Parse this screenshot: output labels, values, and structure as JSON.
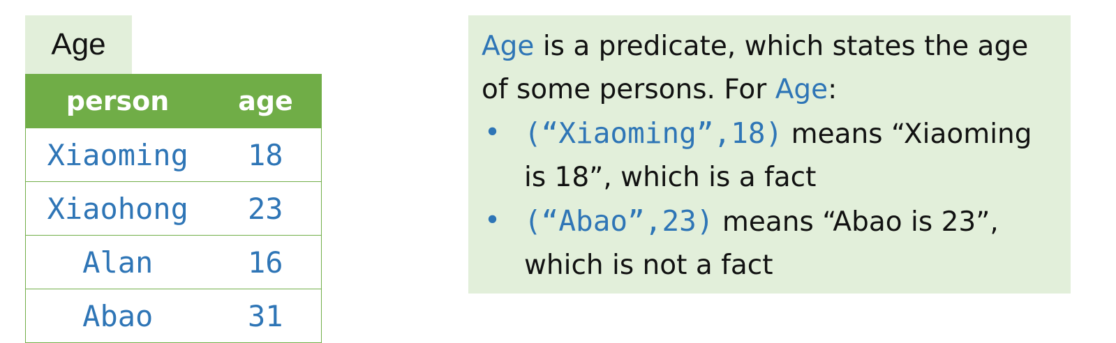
{
  "table": {
    "title": "Age",
    "headers": [
      "person",
      "age"
    ],
    "rows": [
      [
        "Xiaoming",
        "18"
      ],
      [
        "Xiaohong",
        "23"
      ],
      [
        "Alan",
        "16"
      ],
      [
        "Abao",
        "31"
      ]
    ]
  },
  "note": {
    "intro_predicate": "Age",
    "intro_text": " is a predicate, which states the age of some persons. For ",
    "intro_predicate_2": "Age",
    "intro_colon": ":",
    "bullet_symbol": "•",
    "items": [
      {
        "tuple": "(“Xiaoming”,18)",
        "text": " means “Xiaoming is 18”, which is a fact"
      },
      {
        "tuple": "(“Abao”,23)",
        "text": " means “Abao is 23”, which is not a fact"
      }
    ]
  },
  "colors": {
    "header_green": "#70ad47",
    "light_green": "#e2efda",
    "blue_accent": "#2e75b6",
    "text": "#111111"
  }
}
